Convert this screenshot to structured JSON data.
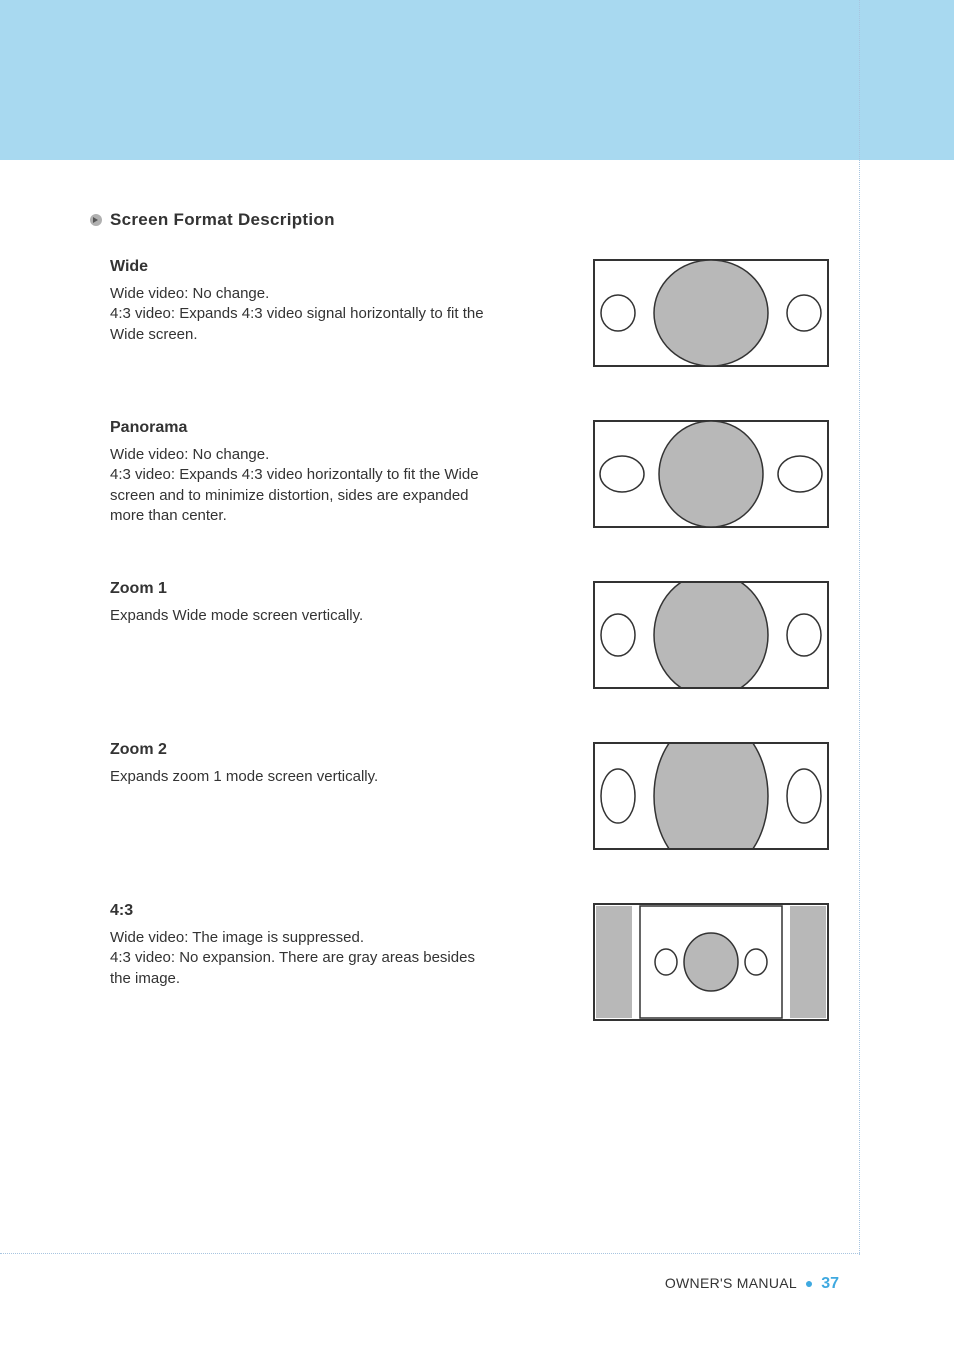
{
  "section_title": "Screen Format Description",
  "formats": [
    {
      "heading": "Wide",
      "desc": "Wide video: No change.\n4:3 video: Expands 4:3 video signal horizontally to fit the Wide screen."
    },
    {
      "heading": "Panorama",
      "desc": "Wide video: No change.\n4:3 video: Expands 4:3 video horizontally to fit the Wide screen and to minimize distortion, sides are expanded more than center."
    },
    {
      "heading": "Zoom 1",
      "desc": "Expands Wide mode screen vertically."
    },
    {
      "heading": "Zoom 2",
      "desc": "Expands zoom 1 mode screen vertically."
    },
    {
      "heading": "4:3",
      "desc": "Wide video: The image is suppressed.\n4:3 video: No expansion. There are gray areas besides the image."
    }
  ],
  "footer": {
    "label": "OWNER'S MANUAL",
    "page": "37"
  }
}
